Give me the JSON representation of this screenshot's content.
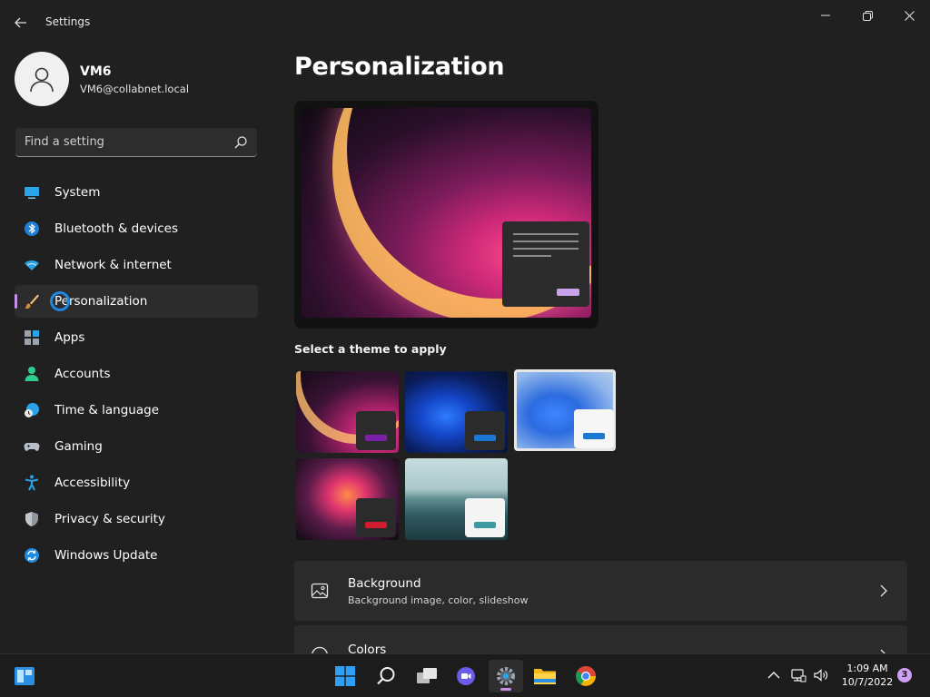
{
  "window": {
    "title": "Settings"
  },
  "profile": {
    "name": "VM6",
    "email": "VM6@collabnet.local"
  },
  "search": {
    "placeholder": "Find a setting"
  },
  "sidebar": {
    "items": [
      {
        "label": "System",
        "icon": "monitor-icon"
      },
      {
        "label": "Bluetooth & devices",
        "icon": "bluetooth-icon"
      },
      {
        "label": "Network & internet",
        "icon": "wifi-icon"
      },
      {
        "label": "Personalization",
        "icon": "paintbrush-icon",
        "active": true
      },
      {
        "label": "Apps",
        "icon": "apps-icon"
      },
      {
        "label": "Accounts",
        "icon": "person-icon"
      },
      {
        "label": "Time & language",
        "icon": "clock-globe-icon"
      },
      {
        "label": "Gaming",
        "icon": "gamepad-icon"
      },
      {
        "label": "Accessibility",
        "icon": "accessibility-icon"
      },
      {
        "label": "Privacy & security",
        "icon": "shield-icon"
      },
      {
        "label": "Windows Update",
        "icon": "sync-icon"
      }
    ]
  },
  "main": {
    "title": "Personalization",
    "themes_label": "Select a theme to apply",
    "cards": [
      {
        "title": "Background",
        "subtitle": "Background image, color, slideshow",
        "icon": "image-icon"
      },
      {
        "title": "Colors",
        "subtitle": "",
        "icon": "palette-icon"
      }
    ]
  },
  "colors": {
    "accent": "#c690e8",
    "background": "#202020",
    "card": "#2b2b2b"
  },
  "taskbar": {
    "time": "1:09 AM",
    "date": "10/7/2022",
    "notifications": "3"
  }
}
